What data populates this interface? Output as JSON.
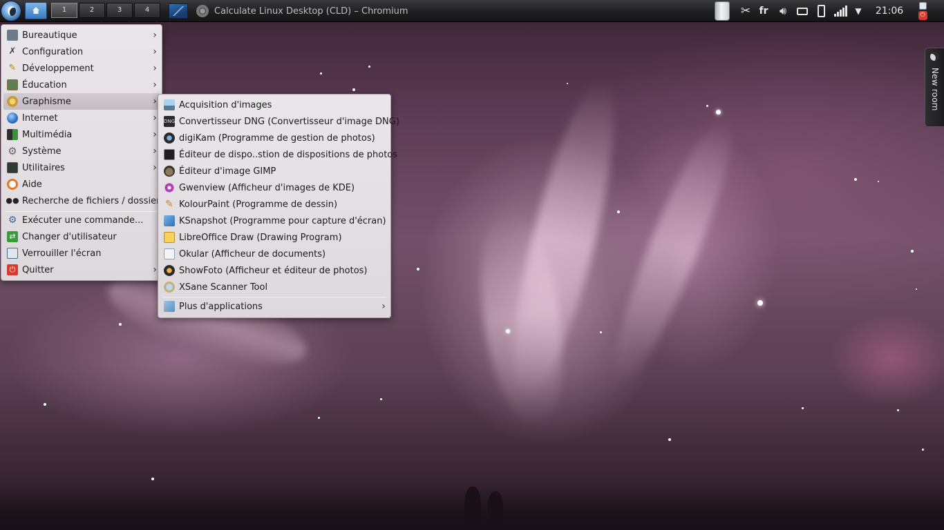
{
  "taskbar": {
    "desktops": [
      "1",
      "2",
      "3",
      "4"
    ],
    "active_window_title": "Calculate Linux Desktop (CLD) – Chromium",
    "keyboard_layout": "fr",
    "clock": "21:06"
  },
  "side_widget": {
    "label": "New room"
  },
  "main_menu": {
    "items": [
      {
        "label": "Bureautique",
        "icon": "office-icon",
        "submenu": true
      },
      {
        "label": "Configuration",
        "icon": "tools-icon",
        "submenu": true
      },
      {
        "label": "Développement",
        "icon": "development-icon",
        "submenu": true
      },
      {
        "label": "Éducation",
        "icon": "education-icon",
        "submenu": true
      },
      {
        "label": "Graphisme",
        "icon": "graphics-icon",
        "submenu": true,
        "highlighted": true
      },
      {
        "label": "Internet",
        "icon": "globe-icon",
        "submenu": true
      },
      {
        "label": "Multimédia",
        "icon": "multimedia-icon",
        "submenu": true
      },
      {
        "label": "Système",
        "icon": "system-gear-icon",
        "submenu": true
      },
      {
        "label": "Utilitaires",
        "icon": "utilities-icon",
        "submenu": true
      },
      {
        "label": "Aide",
        "icon": "help-lifebuoy-icon",
        "submenu": false
      },
      {
        "label": "Recherche de fichiers / dossiers",
        "icon": "binoculars-icon",
        "submenu": false
      },
      {
        "label": "Exécuter une commande...",
        "icon": "run-command-icon",
        "submenu": false
      },
      {
        "label": "Changer d'utilisateur",
        "icon": "switch-user-icon",
        "submenu": false
      },
      {
        "label": "Verrouiller l'écran",
        "icon": "lock-screen-icon",
        "submenu": false
      },
      {
        "label": "Quitter",
        "icon": "quit-power-icon",
        "submenu": true
      }
    ]
  },
  "graphics_submenu": {
    "items": [
      {
        "label": "Acquisition d'images",
        "icon": "scanner-icon"
      },
      {
        "label": "Convertisseur DNG (Convertisseur d'image DNG)",
        "icon": "dng-converter-icon"
      },
      {
        "label": "digiKam (Programme de gestion de photos)",
        "icon": "digikam-icon"
      },
      {
        "label": "Éditeur de dispo..stion de dispositions de photos",
        "icon": "photo-layout-icon"
      },
      {
        "label": "Éditeur d'image GIMP",
        "icon": "gimp-icon"
      },
      {
        "label": "Gwenview (Afficheur d'images de KDE)",
        "icon": "gwenview-icon"
      },
      {
        "label": "KolourPaint (Programme de dessin)",
        "icon": "kolourpaint-icon"
      },
      {
        "label": "KSnapshot (Programme pour capture d'écran)",
        "icon": "ksnapshot-icon"
      },
      {
        "label": "LibreOffice Draw (Drawing Program)",
        "icon": "libreoffice-draw-icon"
      },
      {
        "label": "Okular (Afficheur de documents)",
        "icon": "okular-icon"
      },
      {
        "label": "ShowFoto (Afficheur et éditeur de photos)",
        "icon": "showfoto-icon"
      },
      {
        "label": "XSane Scanner Tool",
        "icon": "xsane-icon"
      },
      {
        "label": "Plus d'applications",
        "icon": "more-apps-icon",
        "submenu": true
      }
    ]
  }
}
